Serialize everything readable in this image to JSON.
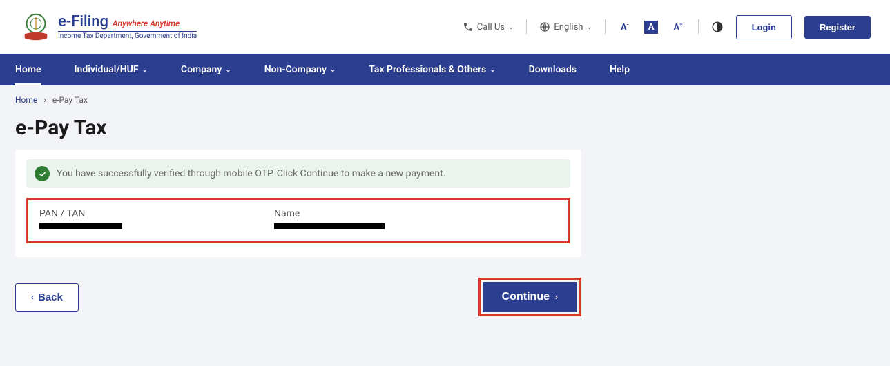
{
  "header": {
    "brand_name": "e-Filing",
    "brand_tag": "Anywhere Anytime",
    "brand_sub": "Income Tax Department, Government of India",
    "call_us": "Call Us",
    "language": "English",
    "login": "Login",
    "register": "Register"
  },
  "nav": {
    "items": [
      {
        "label": "Home",
        "dropdown": false,
        "active": true
      },
      {
        "label": "Individual/HUF",
        "dropdown": true
      },
      {
        "label": "Company",
        "dropdown": true
      },
      {
        "label": "Non-Company",
        "dropdown": true
      },
      {
        "label": "Tax Professionals & Others",
        "dropdown": true
      },
      {
        "label": "Downloads",
        "dropdown": false
      },
      {
        "label": "Help",
        "dropdown": false
      }
    ]
  },
  "breadcrumb": {
    "home": "Home",
    "current": "e-Pay Tax"
  },
  "main": {
    "title": "e-Pay Tax",
    "alert": "You have successfully verified through mobile OTP. Click Continue to make a new payment.",
    "field1_label": "PAN / TAN",
    "field2_label": "Name",
    "back": "Back",
    "continue": "Continue"
  }
}
